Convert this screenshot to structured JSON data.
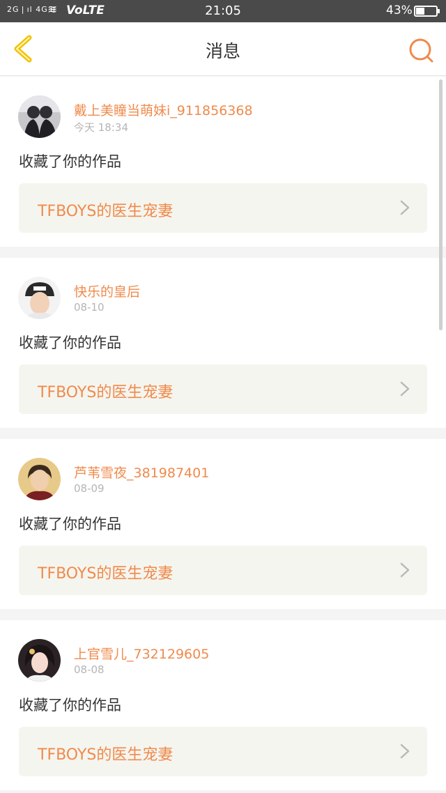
{
  "status_bar": {
    "signal": "2G | ıl 4G ıl",
    "volte": "VoLTE",
    "time": "21:05",
    "battery_text": "43%",
    "battery_level": 0.43
  },
  "header": {
    "title": "消息"
  },
  "messages": [
    {
      "username": "戴上美瞳当萌妹i_911856368",
      "time": "今天 18:34",
      "action": "收藏了你的作品",
      "work_title": "TFBOYS的医生宠妻"
    },
    {
      "username": "快乐的皇后",
      "time": "08-10",
      "action": "收藏了你的作品",
      "work_title": "TFBOYS的医生宠妻"
    },
    {
      "username": "芦苇雪夜_381987401",
      "time": "08-09",
      "action": "收藏了你的作品",
      "work_title": "TFBOYS的医生宠妻"
    },
    {
      "username": "上官雪儿_732129605",
      "time": "08-08",
      "action": "收藏了你的作品",
      "work_title": "TFBOYS的医生宠妻"
    }
  ],
  "colors": {
    "accent": "#f08a4b",
    "back_icon": "#f2c200",
    "card_box": "#f5f5ef"
  }
}
